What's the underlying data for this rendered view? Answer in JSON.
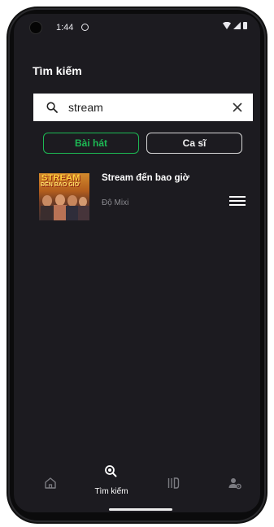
{
  "status_bar": {
    "time": "1:44"
  },
  "header": {
    "title": "Tìm kiếm"
  },
  "search": {
    "value": "stream",
    "placeholder": ""
  },
  "tabs": [
    {
      "label": "Bài hát",
      "selected": true
    },
    {
      "label": "Ca sĩ",
      "selected": false
    }
  ],
  "results": [
    {
      "title": "Stream đến bao giờ",
      "artist": "Độ Mixi",
      "cover_text": "STREAM",
      "cover_subtext": "ĐẾN BAO GIỜ"
    }
  ],
  "bottom_nav": {
    "items": [
      {
        "icon": "home-icon",
        "label": ""
      },
      {
        "icon": "search-icon",
        "label": "Tìm kiếm",
        "active": true
      },
      {
        "icon": "library-icon",
        "label": ""
      },
      {
        "icon": "account-settings-icon",
        "label": ""
      }
    ]
  },
  "colors": {
    "background": "#1c1b20",
    "accent": "#1db954",
    "text": "#ffffff",
    "muted": "#8b8b90"
  }
}
